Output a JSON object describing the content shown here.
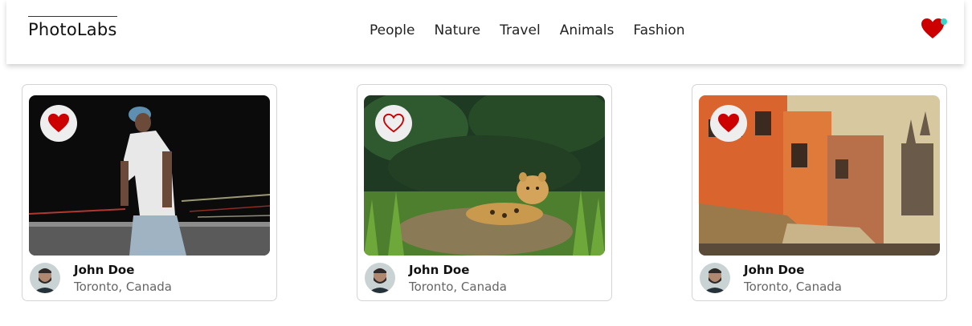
{
  "app": {
    "logo": "PhotoLabs"
  },
  "nav": {
    "topics": [
      "People",
      "Nature",
      "Travel",
      "Animals",
      "Fashion"
    ]
  },
  "favorites": {
    "icon": "heart-icon",
    "has_notification": true,
    "color": "#cc0000",
    "notification_color": "#38d3c9"
  },
  "photos": [
    {
      "liked": true,
      "name": "John Doe",
      "location": "Toronto, Canada",
      "subject": "man in cap walking at night"
    },
    {
      "liked": false,
      "name": "John Doe",
      "location": "Toronto, Canada",
      "subject": "jaguar resting in grass"
    },
    {
      "liked": true,
      "name": "John Doe",
      "location": "Toronto, Canada",
      "subject": "orange buildings and temple spires"
    }
  ]
}
